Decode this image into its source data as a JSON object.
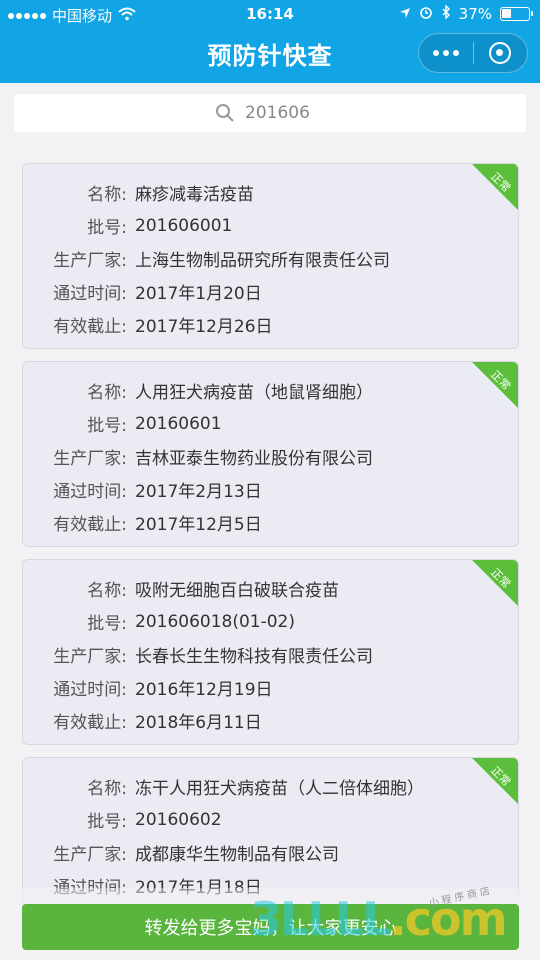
{
  "status": {
    "carrier": "中国移动",
    "time": "16:14",
    "battery": "37%",
    "battery_level": 0.37
  },
  "nav": {
    "title": "预防针快查"
  },
  "search": {
    "value": "201606"
  },
  "labels": {
    "name": "名称:",
    "batch": "批号:",
    "maker": "生产厂家:",
    "pass_time": "通过时间:",
    "expiry": "有效截止:"
  },
  "items": [
    {
      "name": "麻疹减毒活疫苗",
      "batch": "201606001",
      "maker": "上海生物制品研究所有限责任公司",
      "pass_time": "2017年1月20日",
      "expiry": "2017年12月26日",
      "status": "正常"
    },
    {
      "name": "人用狂犬病疫苗（地鼠肾细胞）",
      "batch": "20160601",
      "maker": "吉林亚泰生物药业股份有限公司",
      "pass_time": "2017年2月13日",
      "expiry": "2017年12月5日",
      "status": "正常"
    },
    {
      "name": "吸附无细胞百白破联合疫苗",
      "batch": "201606018(01-02)",
      "maker": "长春长生生物科技有限责任公司",
      "pass_time": "2016年12月19日",
      "expiry": "2018年6月11日",
      "status": "正常"
    },
    {
      "name": "冻干人用狂犬病疫苗（人二倍体细胞）",
      "batch": "20160602",
      "maker": "成都康华生物制品有限公司",
      "pass_time": "2017年1月18日",
      "expiry": "",
      "status": "正常"
    }
  ],
  "share_button": "转发给更多宝妈，让大家更安心",
  "watermark": {
    "text": "3LLLL",
    "suffix": ".com",
    "cn": "小程序商店"
  },
  "colors": {
    "primary": "#11a5e6",
    "green": "#5ab53e",
    "card": "#ebecf3"
  }
}
